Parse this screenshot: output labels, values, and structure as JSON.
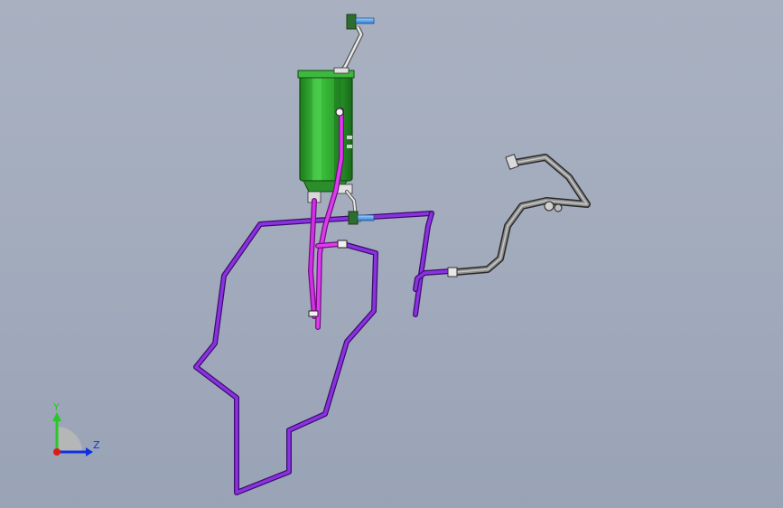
{
  "triad": {
    "y_label": "Y",
    "z_label": "Z",
    "y_color": "#28c828",
    "z_color": "#1030e0",
    "x_color": "#e01818"
  },
  "colors": {
    "canister": "#2fae2f",
    "canister_dark": "#1d7a1d",
    "purge_line": "#d027e8",
    "vent_line": "#7d2bd6",
    "fill_line": "#6f6f6f",
    "fastener": "#4aa0e8"
  }
}
